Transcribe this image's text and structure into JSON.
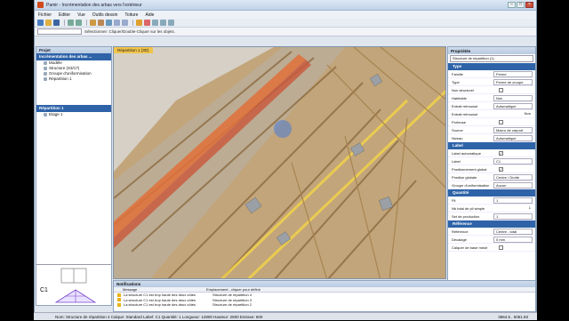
{
  "window": {
    "title": "Pamir - Incrémentation des arbas vers l'extérieur",
    "minimize": "–",
    "maximize": "□",
    "close": "×"
  },
  "menu": [
    "Fichier",
    "Editer",
    "Vue",
    "Outils dessin",
    "Toiture",
    "Aide"
  ],
  "command_prompt": "Sélectionner: Cliquer/Double-Cliquer sur les objets.",
  "project_panel": {
    "header": "Projet",
    "section": "Incrémentation des arbas ...",
    "items": [
      "Modèle",
      "Structure (S3/17)",
      "Groupe d'uniformisation",
      "Répartition 1"
    ],
    "repartition_header": "Répartition 1",
    "repartition_items": [
      "Etage 1"
    ],
    "thumb_label": "C1"
  },
  "viewport": {
    "tab_label": "Répartition 1 (3D)"
  },
  "properties": {
    "header": "Propriétés",
    "selector": "Structure de répartition (1)",
    "sections": [
      {
        "title": "Type",
        "rows": [
          {
            "label": "Famille",
            "value": "Ferme",
            "kind": "combo"
          },
          {
            "label": "Type",
            "value": "Ferme de croupe",
            "kind": "combo"
          },
          {
            "label": "Non structurel",
            "value": "",
            "kind": "check"
          },
          {
            "label": "Habitable",
            "value": "Non",
            "kind": "combo"
          },
          {
            "label": "Entrait retroussé",
            "value": "Automatique",
            "kind": "combo"
          },
          {
            "label": "Entrait retroussé",
            "value": "Non",
            "kind": "plain"
          },
          {
            "label": "Porteuse",
            "value": "",
            "kind": "check"
          },
          {
            "label": "Source",
            "value": "Macro de carport",
            "kind": "combo"
          },
          {
            "label": "Niveau",
            "value": "Automatique",
            "kind": "combo"
          }
        ]
      },
      {
        "title": "Label",
        "rows": [
          {
            "label": "Label automatique",
            "value": "✓",
            "kind": "check"
          },
          {
            "label": "Label",
            "value": "C1",
            "kind": "combo"
          },
          {
            "label": "Positionnement global",
            "value": "✓",
            "kind": "check"
          },
          {
            "label": "Position globale",
            "value": "Centre / Droite",
            "kind": "combo"
          },
          {
            "label": "Groupe d'uniformisation",
            "value": "Aucun",
            "kind": "combo"
          }
        ]
      },
      {
        "title": "Quantité",
        "rows": [
          {
            "label": "Pli",
            "value": "1",
            "kind": "combo"
          },
          {
            "label": "Nb total de pli simple",
            "value": "1",
            "kind": "plain"
          },
          {
            "label": "Set de production",
            "value": "1",
            "kind": "combo"
          }
        ]
      },
      {
        "title": "Référence",
        "rows": [
          {
            "label": "Référence",
            "value": "Centre - total",
            "kind": "combo"
          },
          {
            "label": "Décalage",
            "value": "0 mm",
            "kind": "combo"
          },
          {
            "label": "Calquer de base miroir",
            "value": "",
            "kind": "check"
          }
        ]
      }
    ]
  },
  "notifications": {
    "header": "Notifications",
    "col_message": "Message",
    "col_location": "Emplacement - cliquer pour définir",
    "rows": [
      {
        "message": "La structure C1 est trop haute des deux côtés",
        "location": "Structure de répartition 4"
      },
      {
        "message": "La structure C1 est trop haute des deux côtés",
        "location": "Structure de répartition 3"
      },
      {
        "message": "La structure C1 est trop haute des deux côtés",
        "location": "Structure de répartition 2"
      }
    ]
  },
  "status": {
    "text": "Nom: Structure de répartition 4  Calque: Standard  Label: C1  Quantité: 1  Longueur: 12800  Hauteur: 2500  Entraxe: 600",
    "coords": "3664.6 , 5061.83"
  },
  "colors": {
    "accent": "#2e63a8",
    "tab": "#f1c44a",
    "wood": "#c9a873",
    "highlight": "#f2d24a"
  }
}
